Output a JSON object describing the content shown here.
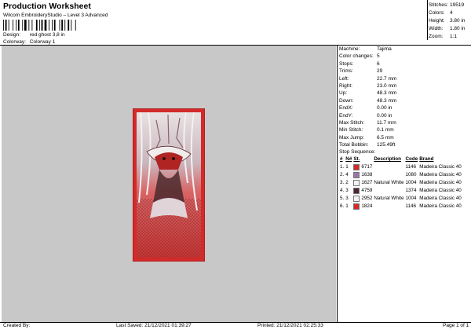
{
  "header": {
    "title": "Production Worksheet",
    "subtitle": "Wilcom EmbroideryStudio – Level 3 Advanced",
    "design_label": "Design:",
    "design_value": "red ghost 3,8 in",
    "colorway_label": "Colorway:",
    "colorway_value": "Colorway 1"
  },
  "stats": [
    {
      "label": "Stitches:",
      "value": "19519"
    },
    {
      "label": "Colors:",
      "value": "4"
    },
    {
      "label": "Height:",
      "value": "3.80 in"
    },
    {
      "label": "Width:",
      "value": "1.80 in"
    },
    {
      "label": "Zoom:",
      "value": "1:1"
    }
  ],
  "machine_info": [
    {
      "label": "Machine:",
      "value": "Tajima"
    },
    {
      "label": "Color changes:",
      "value": "5"
    },
    {
      "label": "Stops:",
      "value": "6"
    },
    {
      "label": "Trims:",
      "value": "29"
    },
    {
      "label": "Left:",
      "value": "22.7 mm"
    },
    {
      "label": "Right:",
      "value": "23.0 mm"
    },
    {
      "label": "Up:",
      "value": "48.3 mm"
    },
    {
      "label": "Down:",
      "value": "48.3 mm"
    },
    {
      "label": "EndX:",
      "value": "0.00 in"
    },
    {
      "label": "EndY:",
      "value": "0.00 in"
    },
    {
      "label": "Max Stitch:",
      "value": "11.7 mm"
    },
    {
      "label": "Min Stitch:",
      "value": "0.1 mm"
    },
    {
      "label": "Max Jump:",
      "value": "6.5 mm"
    },
    {
      "label": "Total Bobbin:",
      "value": "125.49ft"
    }
  ],
  "sequence": {
    "title": "Stop Sequence:",
    "headers": {
      "hash": "#",
      "n": "N#",
      "st": "St.",
      "desc": "Description",
      "code": "Code",
      "brand": "Brand"
    },
    "rows": [
      {
        "idx": "1.",
        "n": "1",
        "swatch": "#d42a2a",
        "st": "6717",
        "desc": "",
        "code": "1146",
        "brand": "Madeira Classic 40"
      },
      {
        "idx": "2.",
        "n": "4",
        "swatch": "#9a76a8",
        "st": "1638",
        "desc": "",
        "code": "1080",
        "brand": "Madeira Classic 40"
      },
      {
        "idx": "3.",
        "n": "2",
        "swatch": "#f4f4f4",
        "st": "1627",
        "desc": "Natural White",
        "code": "1004",
        "brand": "Madeira Classic 40"
      },
      {
        "idx": "4.",
        "n": "3",
        "swatch": "#4a2a2e",
        "st": "4759",
        "desc": "",
        "code": "1374",
        "brand": "Madeira Classic 40"
      },
      {
        "idx": "5.",
        "n": "3",
        "swatch": "#f4f4f4",
        "st": "2952",
        "desc": "Natural White",
        "code": "1004",
        "brand": "Madeira Classic 40"
      },
      {
        "idx": "6.",
        "n": "1",
        "swatch": "#d42a2a",
        "st": "1824",
        "desc": "",
        "code": "1146",
        "brand": "Madeira Classic 40"
      }
    ]
  },
  "footer": {
    "created_by": "Created By:",
    "last_saved": "Last Saved: 21/12/2021 01:39:27",
    "printed": "Printed: 21/12/2021 02:25:33",
    "page": "Page 1 of 1"
  },
  "colors": {
    "canvas_bg": "#c8c8c8",
    "design_red": "#d42a2a",
    "design_dark": "#4a2a2e"
  }
}
